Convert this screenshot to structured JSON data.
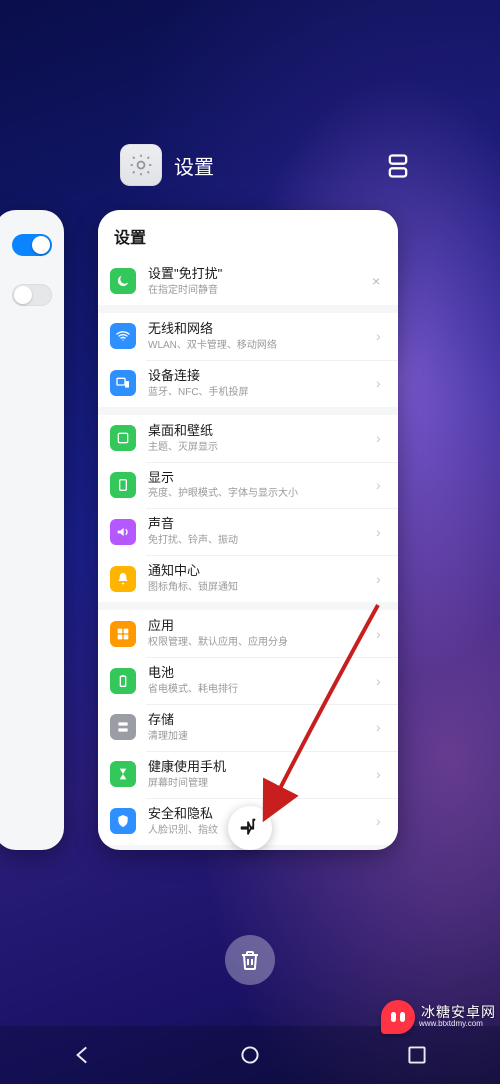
{
  "header": {
    "app_name": "设置",
    "app_icon": "gear-icon"
  },
  "left_card": {
    "toggles": [
      {
        "state": "on"
      },
      {
        "state": "off"
      }
    ]
  },
  "settings_card": {
    "title": "设置",
    "promo": {
      "title": "设置\"免打扰\"",
      "sub": "在指定时间静音",
      "icon": "moon-icon"
    },
    "groups": [
      [
        {
          "icon": "wifi-icon",
          "color": "#2e90ff",
          "title": "无线和网络",
          "sub": "WLAN、双卡管理、移动网络"
        },
        {
          "icon": "devices-icon",
          "color": "#2e90ff",
          "title": "设备连接",
          "sub": "蓝牙、NFC、手机投屏"
        }
      ],
      [
        {
          "icon": "home-icon",
          "color": "#34c759",
          "title": "桌面和壁纸",
          "sub": "主题、灭屏显示"
        },
        {
          "icon": "display-icon",
          "color": "#34c759",
          "title": "显示",
          "sub": "亮度、护眼模式、字体与显示大小"
        },
        {
          "icon": "sound-icon",
          "color": "#b558ff",
          "title": "声音",
          "sub": "免打扰、铃声、振动"
        },
        {
          "icon": "bell-icon",
          "color": "#ffb400",
          "title": "通知中心",
          "sub": "图标角标、锁屏通知"
        }
      ],
      [
        {
          "icon": "apps-icon",
          "color": "#ff9900",
          "title": "应用",
          "sub": "权限管理、默认应用、应用分身"
        },
        {
          "icon": "battery-icon",
          "color": "#34c759",
          "title": "电池",
          "sub": "省电模式、耗电排行"
        },
        {
          "icon": "storage-icon",
          "color": "#9a9da3",
          "title": "存储",
          "sub": "清理加速"
        },
        {
          "icon": "hourglass-icon",
          "color": "#34c759",
          "title": "健康使用手机",
          "sub": "屏幕时间管理"
        },
        {
          "icon": "shield-icon",
          "color": "#2e90ff",
          "title": "安全和隐私",
          "sub": "人脸识别、指纹"
        }
      ]
    ]
  },
  "pin_button": {
    "icon": "pin-icon"
  },
  "trash_button": {
    "icon": "trash-icon"
  },
  "navbar": {
    "back": "back-icon",
    "home": "home-circle-icon",
    "recent": "recent-icon"
  },
  "watermark": {
    "brand": "冰糖安卓网",
    "url": "www.btxtdmy.com"
  }
}
